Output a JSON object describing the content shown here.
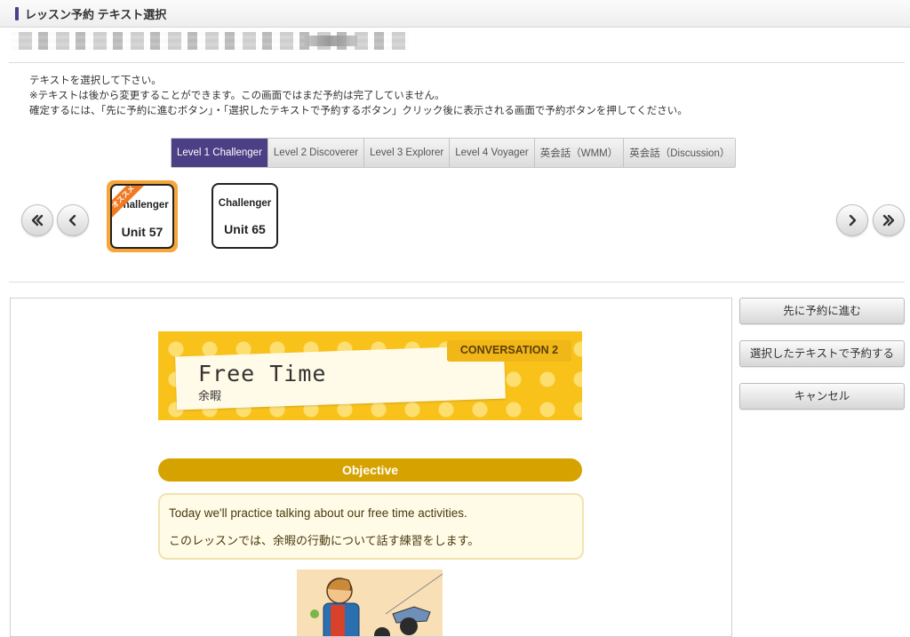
{
  "header": {
    "title": "レッスン予約 テキスト選択"
  },
  "instructions": {
    "line1": "テキストを選択して下さい。",
    "line2": "※テキストは後から変更することができます。この画面ではまだ予約は完了していません。",
    "line3": "確定するには、「先に予約に進むボタン」・「選択したテキストで予約するボタン」クリック後に表示される画面で予約ボタンを押してください。"
  },
  "level_tabs": [
    {
      "label": "Level 1 Challenger",
      "active": true
    },
    {
      "label": "Level 2 Discoverer",
      "active": false
    },
    {
      "label": "Level 3 Explorer",
      "active": false
    },
    {
      "label": "Level 4 Voyager",
      "active": false
    },
    {
      "label": "英会話（WMM）",
      "active": false
    },
    {
      "label": "英会話（Discussion）",
      "active": false
    }
  ],
  "carousel": {
    "cards": [
      {
        "level": "Challenger",
        "unit": "Unit 57",
        "selected": true,
        "ribbon": "オススメ"
      },
      {
        "level": "Challenger",
        "unit": "Unit 65",
        "selected": false
      }
    ],
    "icons": {
      "first": "double-chevron-left-icon",
      "prev": "chevron-left-icon",
      "next": "chevron-right-icon",
      "last": "double-chevron-right-icon"
    }
  },
  "lesson": {
    "banner_tag": "CONVERSATION 2",
    "title": "Free Time",
    "subtitle": "余暇",
    "objective_heading": "Objective",
    "objective_en": "Today we'll practice talking about our free time activities.",
    "objective_ja": "このレッスンでは、余暇の行動について話す練習をします。"
  },
  "actions": {
    "proceed": "先に予約に進む",
    "book_selected": "選択したテキストで予約する",
    "cancel": "キャンセル"
  },
  "colors": {
    "accent_purple": "#4c3f85",
    "selected_border": "#f6a63a",
    "banner_yellow": "#f8c21b",
    "objective_gold": "#d6a200"
  }
}
